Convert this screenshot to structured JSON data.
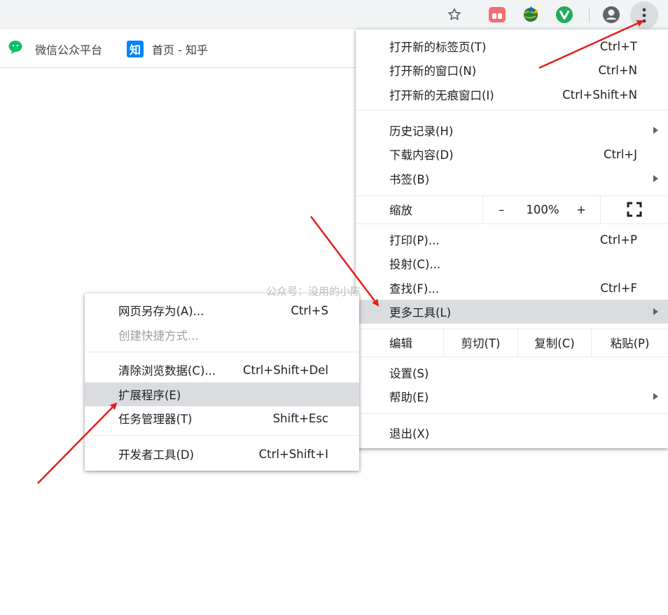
{
  "toolbar": {
    "icons": [
      "star-icon",
      "extension-icon",
      "extension-globe-icon",
      "extension-v-icon",
      "profile-icon",
      "more-vert-icon"
    ],
    "menu_highlight": "#dadce0"
  },
  "bookmarks": [
    {
      "label": "微信公众平台",
      "icon": "wechat-icon",
      "color": "#07c160"
    },
    {
      "label": "首页 - 知乎",
      "icon": "zhihu-icon",
      "icon_text": "知",
      "color": "#0084ff"
    }
  ],
  "main_menu": {
    "new_tab": {
      "label": "打开新的标签页(T)",
      "shortcut": "Ctrl+T"
    },
    "new_window": {
      "label": "打开新的窗口(N)",
      "shortcut": "Ctrl+N"
    },
    "incognito": {
      "label": "打开新的无痕窗口(I)",
      "shortcut": "Ctrl+Shift+N"
    },
    "history": {
      "label": "历史记录(H)"
    },
    "downloads": {
      "label": "下载内容(D)",
      "shortcut": "Ctrl+J"
    },
    "bookmarks": {
      "label": "书签(B)"
    },
    "zoom": {
      "label": "缩放",
      "minus": "–",
      "value": "100%",
      "plus": "+"
    },
    "print": {
      "label": "打印(P)...",
      "shortcut": "Ctrl+P"
    },
    "cast": {
      "label": "投射(C)..."
    },
    "find": {
      "label": "查找(F)...",
      "shortcut": "Ctrl+F"
    },
    "more_tools": {
      "label": "更多工具(L)"
    },
    "edit": {
      "label": "编辑",
      "cut": "剪切(T)",
      "copy": "复制(C)",
      "paste": "粘贴(P)"
    },
    "settings": {
      "label": "设置(S)"
    },
    "help": {
      "label": "帮助(E)"
    },
    "exit": {
      "label": "退出(X)"
    }
  },
  "sub_menu": {
    "save_page": {
      "label": "网页另存为(A)...",
      "shortcut": "Ctrl+S"
    },
    "create_shortcut": {
      "label": "创建快捷方式..."
    },
    "clear_data": {
      "label": "清除浏览数据(C)...",
      "shortcut": "Ctrl+Shift+Del"
    },
    "extensions": {
      "label": "扩展程序(E)"
    },
    "task_manager": {
      "label": "任务管理器(T)",
      "shortcut": "Shift+Esc"
    },
    "dev_tools": {
      "label": "开发者工具(D)",
      "shortcut": "Ctrl+Shift+I"
    }
  },
  "watermark": "公众号：没用的小陈",
  "annotation_color": "#e0201a"
}
